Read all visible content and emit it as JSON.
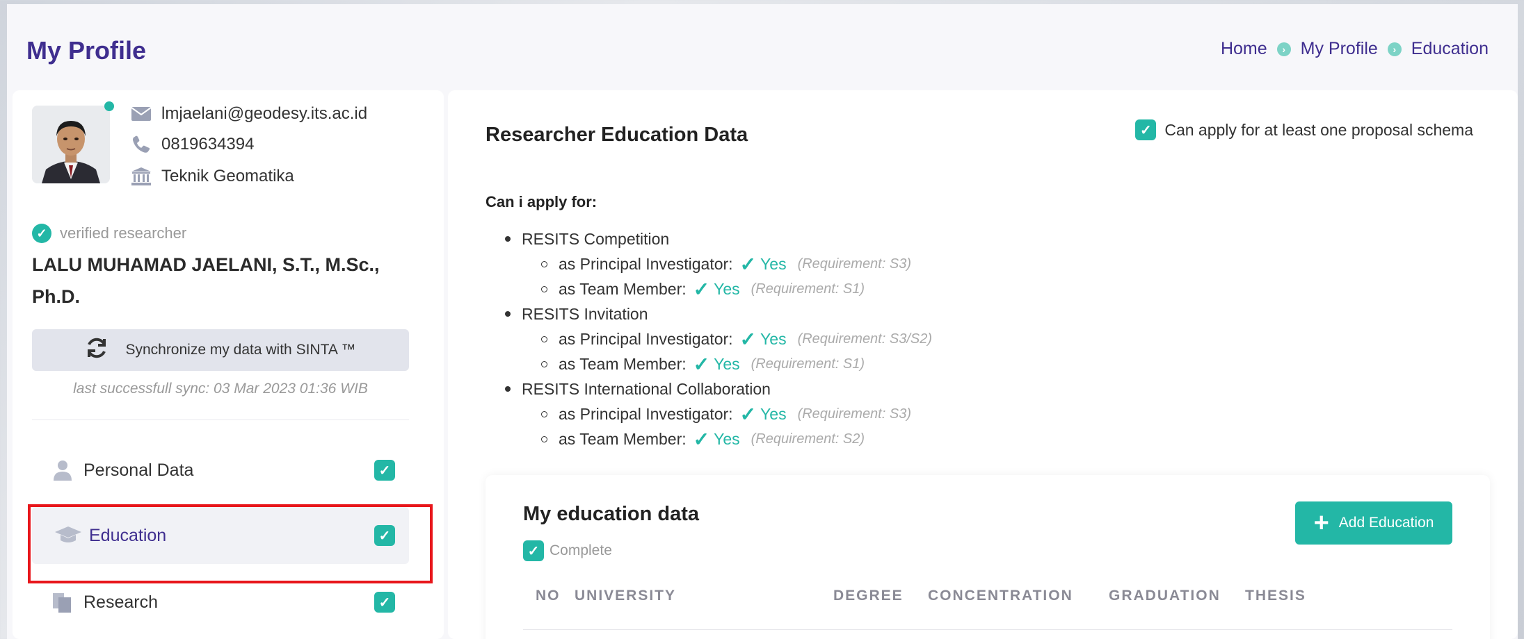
{
  "header": {
    "title": "My Profile",
    "breadcrumb": [
      "Home",
      "My Profile",
      "Education"
    ]
  },
  "profile": {
    "email": "lmjaelani@geodesy.its.ac.id",
    "phone": "0819634394",
    "department": "Teknik Geomatika",
    "verified_label": "verified researcher",
    "name": "LALU MUHAMAD JAELANI, S.T., M.Sc., Ph.D.",
    "sync_button": "Synchronize my data with SINTA ™",
    "sync_note": "last successfull sync: 03 Mar 2023 01:36 WIB"
  },
  "sidebar": {
    "items": [
      {
        "label": "Personal Data",
        "icon": "user-icon",
        "complete": true
      },
      {
        "label": "Education",
        "icon": "graduation-cap-icon",
        "complete": true,
        "active": true
      },
      {
        "label": "Research",
        "icon": "documents-icon",
        "complete": true
      }
    ]
  },
  "main": {
    "title": "Researcher Education Data",
    "schema_note": "Can apply for at least one proposal schema",
    "apply_label": "Can i apply for:",
    "schemes": [
      {
        "name": "RESITS Competition",
        "roles": [
          {
            "role": "as Principal Investigator:",
            "status": "Yes",
            "requirement": "(Requirement: S3)"
          },
          {
            "role": "as Team Member:",
            "status": "Yes",
            "requirement": "(Requirement: S1)"
          }
        ]
      },
      {
        "name": "RESITS Invitation",
        "roles": [
          {
            "role": "as Principal Investigator:",
            "status": "Yes",
            "requirement": "(Requirement: S3/S2)"
          },
          {
            "role": "as Team Member:",
            "status": "Yes",
            "requirement": "(Requirement: S1)"
          }
        ]
      },
      {
        "name": "RESITS International Collaboration",
        "roles": [
          {
            "role": "as Principal Investigator:",
            "status": "Yes",
            "requirement": "(Requirement: S3)"
          },
          {
            "role": "as Team Member:",
            "status": "Yes",
            "requirement": "(Requirement: S2)"
          }
        ]
      }
    ]
  },
  "education": {
    "title": "My education data",
    "status": "Complete",
    "add_button": "Add Education",
    "columns": [
      "NO",
      "UNIVERSITY",
      "DEGREE",
      "CONCENTRATION",
      "GRADUATION",
      "THESIS"
    ]
  },
  "colors": {
    "accent": "#23b7a6",
    "brand": "#3f2e8f",
    "highlight": "#e8161b"
  }
}
